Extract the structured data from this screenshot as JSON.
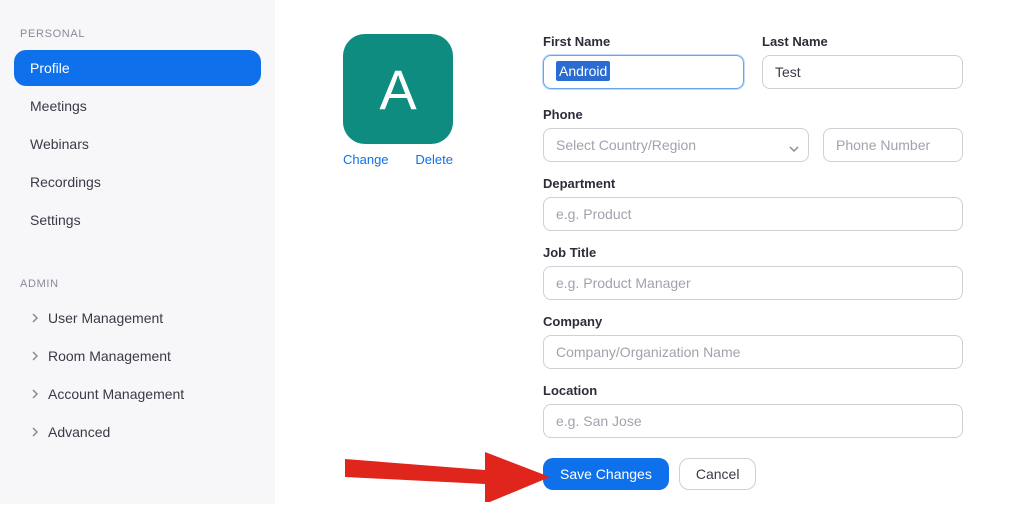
{
  "sidebar": {
    "personal_header": "PERSONAL",
    "admin_header": "ADMIN",
    "personal_items": [
      {
        "label": "Profile"
      },
      {
        "label": "Meetings"
      },
      {
        "label": "Webinars"
      },
      {
        "label": "Recordings"
      },
      {
        "label": "Settings"
      }
    ],
    "admin_items": [
      {
        "label": "User Management"
      },
      {
        "label": "Room Management"
      },
      {
        "label": "Account Management"
      },
      {
        "label": "Advanced"
      }
    ]
  },
  "avatar": {
    "initial": "A",
    "change_label": "Change",
    "delete_label": "Delete"
  },
  "form": {
    "first_name_label": "First Name",
    "first_name_value": "Android",
    "last_name_label": "Last Name",
    "last_name_value": "Test",
    "phone_label": "Phone",
    "phone_region_placeholder": "Select Country/Region",
    "phone_number_placeholder": "Phone Number",
    "department_label": "Department",
    "department_placeholder": "e.g. Product",
    "job_title_label": "Job Title",
    "job_title_placeholder": "e.g. Product Manager",
    "company_label": "Company",
    "company_placeholder": "Company/Organization Name",
    "location_label": "Location",
    "location_placeholder": "e.g. San Jose",
    "save_label": "Save Changes",
    "cancel_label": "Cancel"
  }
}
